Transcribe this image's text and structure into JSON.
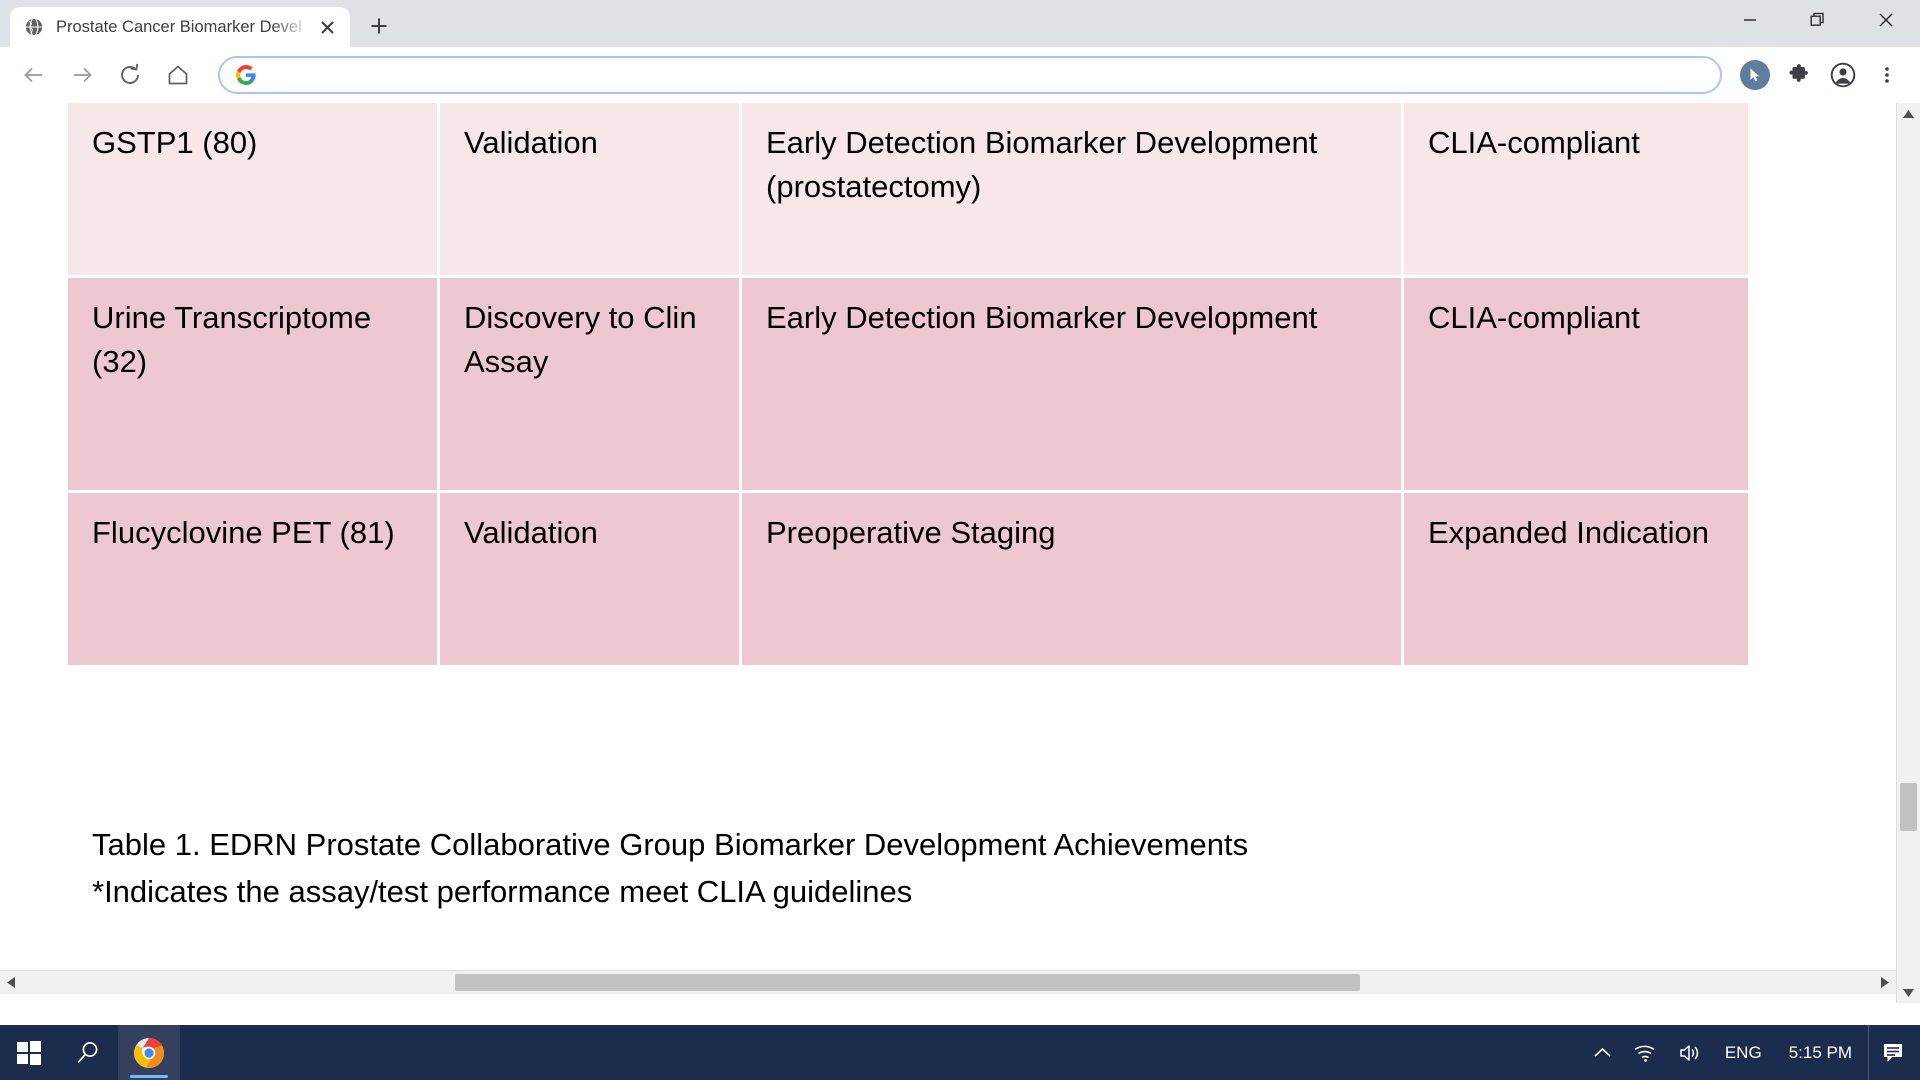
{
  "browser": {
    "tab": {
      "title": "Prostate Cancer Biomarker Devel",
      "favicon_icon": "globe-icon",
      "close_icon": "close-icon"
    },
    "new_tab_icon": "plus-icon",
    "window_controls": {
      "minimize_icon": "minimize-icon",
      "restore_icon": "restore-icon",
      "close_icon": "close-icon"
    },
    "toolbar": {
      "back_icon": "back-arrow-icon",
      "forward_icon": "forward-arrow-icon",
      "reload_icon": "reload-icon",
      "home_icon": "home-icon",
      "address_value": "",
      "address_placeholder": "",
      "search_engine_icon": "google-g-icon",
      "cursor_icon": "cursor-pointer-icon",
      "extensions_icon": "puzzle-piece-icon",
      "profile_icon": "account-avatar-icon",
      "menu_icon": "three-dot-menu-icon"
    }
  },
  "page": {
    "table": {
      "rows": [
        {
          "shade": "light",
          "cells": [
            "GSTP1 (80)",
            "Validation",
            "Early Detection Biomarker Development (prostatectomy)",
            "CLIA-compliant"
          ]
        },
        {
          "shade": "dark",
          "cells": [
            "Urine Transcriptome (32)",
            "Discovery to Clin Assay",
            "Early Detection Biomarker Development",
            "CLIA-compliant"
          ]
        },
        {
          "shade": "dark",
          "cells": [
            "Flucyclovine PET (81)",
            "Validation",
            "Preoperative Staging",
            "Expanded Indication"
          ]
        }
      ]
    },
    "caption_line1": "Table 1. EDRN Prostate Collaborative Group Biomarker Development Achievements",
    "caption_line2": "*Indicates the assay/test performance meet CLIA guidelines"
  },
  "scrollbars": {
    "vertical_up_icon": "scroll-up-arrow-icon",
    "vertical_down_icon": "scroll-down-arrow-icon",
    "horizontal_left_icon": "scroll-left-arrow-icon",
    "horizontal_right_icon": "scroll-right-arrow-icon"
  },
  "taskbar": {
    "start_icon": "windows-start-icon",
    "search_icon": "search-icon",
    "chrome_icon": "chrome-icon",
    "tray": {
      "overflow_icon": "chevron-up-icon",
      "network_icon": "wifi-icon",
      "volume_icon": "speaker-icon",
      "language": "ENG",
      "clock": "5:15 PM",
      "notifications_icon": "notification-icon"
    }
  },
  "colors": {
    "table_row_light": "#f7e7e8",
    "table_row_dark": "#eec8d0",
    "titlebar_bg": "#dee1e6",
    "taskbar_bg": "#1c2c4c",
    "omnibox_border": "#a9c7f2"
  }
}
